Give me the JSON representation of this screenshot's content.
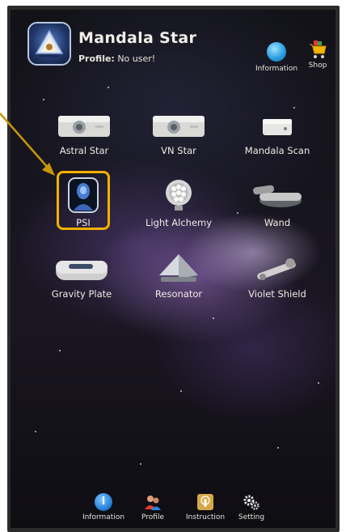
{
  "header": {
    "app_title": "Mandala Star",
    "profile_label": "Profile:",
    "profile_value": "No user!",
    "info_label": "Information",
    "shop_label": "Shop"
  },
  "devices": [
    {
      "label": "Astral Star",
      "icon": "projector-icon"
    },
    {
      "label": "VN Star",
      "icon": "projector-icon"
    },
    {
      "label": "Mandala Scan",
      "icon": "scanner-device-icon"
    },
    {
      "label": "PSI",
      "icon": "psi-head-icon",
      "highlighted": true
    },
    {
      "label": "Light Alchemy",
      "icon": "led-lamp-icon"
    },
    {
      "label": "Wand",
      "icon": "wand-device-icon"
    },
    {
      "label": "Gravity Plate",
      "icon": "gravity-plate-icon"
    },
    {
      "label": "Resonator",
      "icon": "pyramid-icon"
    },
    {
      "label": "Violet Shield",
      "icon": "violet-shield-icon"
    }
  ],
  "bottom_nav": [
    {
      "label": "Information",
      "icon": "info-icon"
    },
    {
      "label": "Profile",
      "icon": "profile-icon"
    },
    {
      "label": "Instruction",
      "icon": "instruction-icon"
    },
    {
      "label": "Setting",
      "icon": "gear-icon"
    }
  ],
  "colors": {
    "highlight": "#f2b100",
    "annotation_arrow": "#c8960a",
    "text": "#efebe4"
  }
}
